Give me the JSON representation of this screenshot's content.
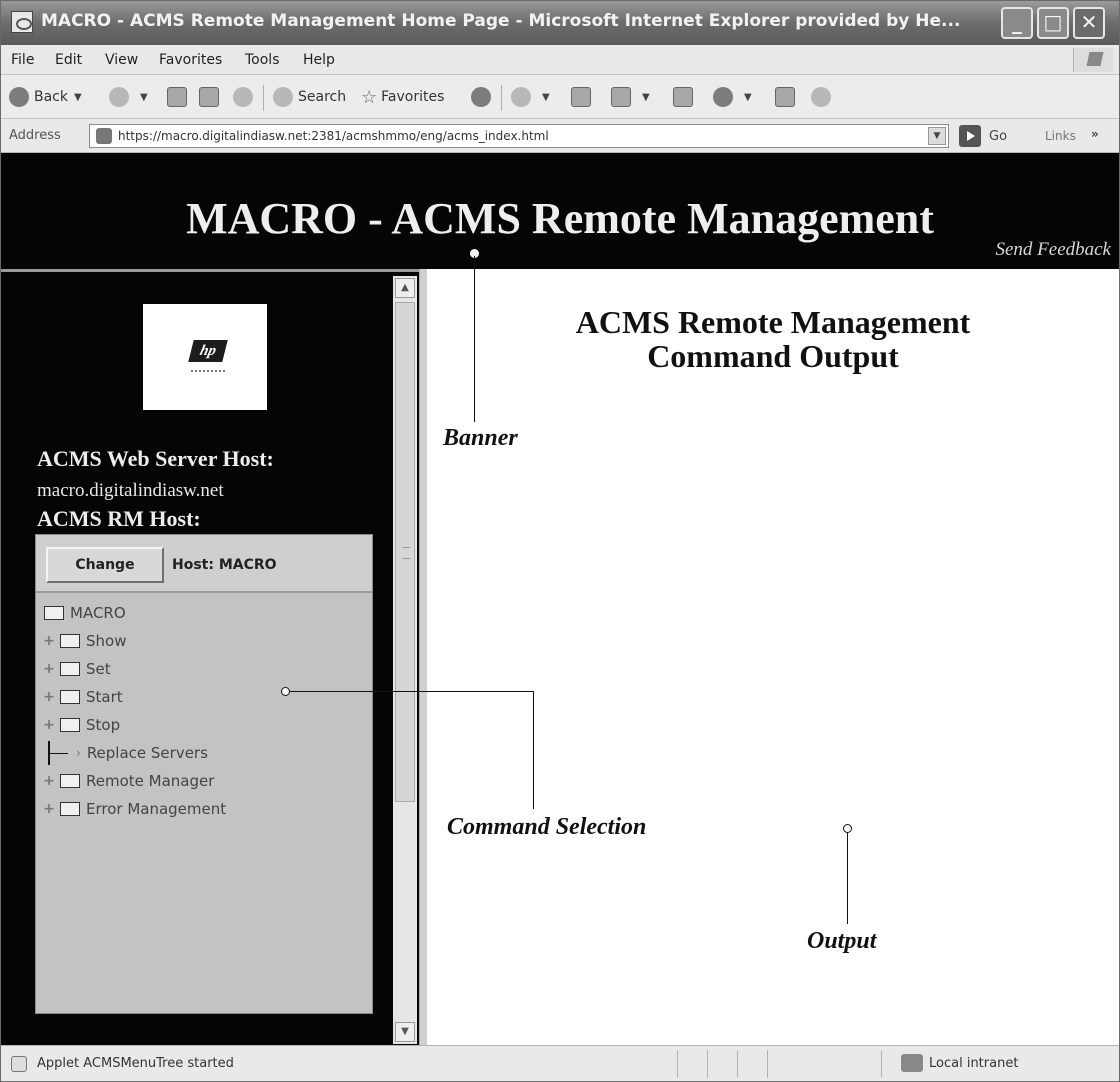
{
  "window": {
    "title": "MACRO - ACMS Remote Management Home Page - Microsoft Internet Explorer provided by He...",
    "minimize_glyph": "_",
    "maximize_glyph": "□",
    "close_glyph": "✕"
  },
  "menu": {
    "items": [
      "File",
      "Edit",
      "View",
      "Favorites",
      "Tools",
      "Help"
    ]
  },
  "toolbar": {
    "back_label": "Back",
    "search_label": "Search",
    "favorites_label": "Favorites"
  },
  "address": {
    "label": "Address",
    "url": "https://macro.digitalindiasw.net:2381/acmshmmo/eng/acms_index.html",
    "go_label": "Go",
    "links_label": "Links",
    "links_chevron": "»"
  },
  "banner": {
    "title": "MACRO - ACMS Remote Management",
    "feedback": "Send Feedback"
  },
  "left": {
    "logo_text": "hp",
    "web_host_label": "ACMS Web Server Host:",
    "web_host_value": "macro.digitalindiasw.net",
    "rm_host_label": "ACMS RM Host:",
    "change_button": "Change",
    "host_label": "Host: MACRO",
    "tree": {
      "root": "MACRO",
      "items": [
        {
          "label": "Show",
          "expandable": true
        },
        {
          "label": "Set",
          "expandable": true
        },
        {
          "label": "Start",
          "expandable": true
        },
        {
          "label": "Stop",
          "expandable": true
        },
        {
          "label": "Replace Servers",
          "expandable": false
        },
        {
          "label": "Remote Manager",
          "expandable": true
        },
        {
          "label": "Error Management",
          "expandable": true
        }
      ]
    }
  },
  "output": {
    "title_line1": "ACMS Remote Management",
    "title_line2": "Command Output"
  },
  "callouts": {
    "banner": "Banner",
    "command_selection": "Command Selection",
    "output": "Output"
  },
  "status": {
    "text": "Applet ACMSMenuTree started",
    "zone": "Local intranet"
  },
  "icons": {
    "app": "ie-icon",
    "back": "back-arrow-icon",
    "forward": "forward-arrow-icon",
    "stop": "stop-icon",
    "refresh": "refresh-icon",
    "home": "home-icon",
    "search": "search-icon",
    "favorites": "star-icon",
    "media": "media-icon",
    "mail": "mail-icon",
    "print": "printer-icon",
    "edit": "edit-icon",
    "discuss": "discuss-icon",
    "messenger": "messenger-icon",
    "research": "research-icon",
    "page": "page-icon",
    "go": "go-arrow-icon",
    "folder": "folder-icon",
    "zone": "intranet-icon"
  }
}
